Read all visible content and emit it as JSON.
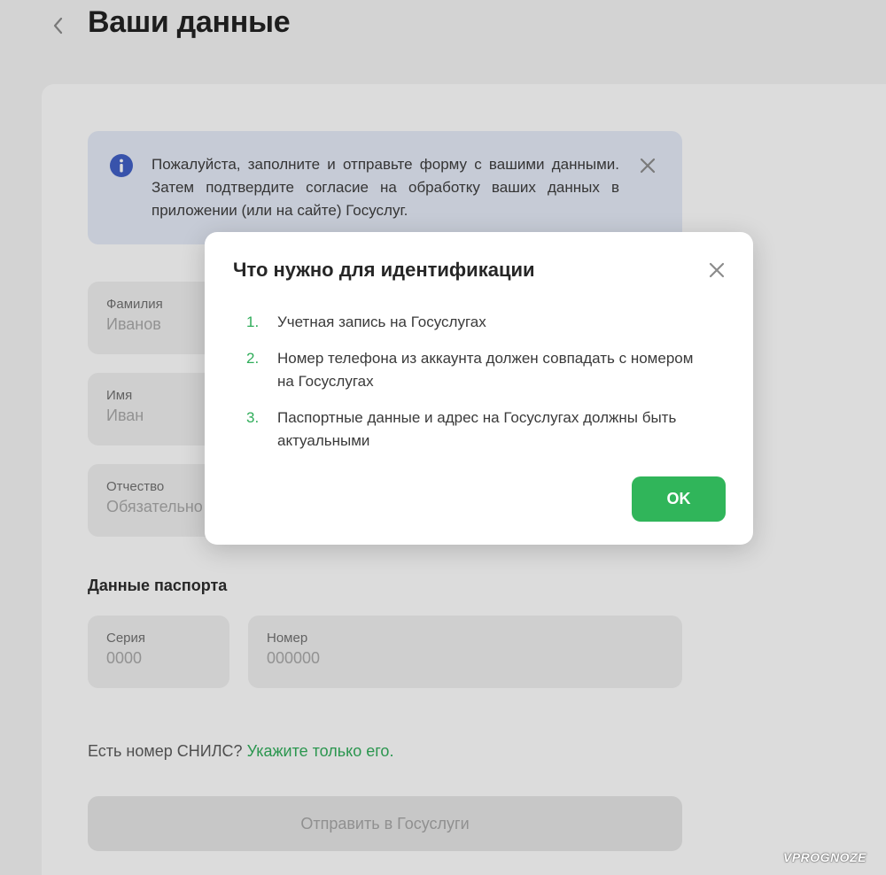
{
  "header": {
    "title": "Ваши данные"
  },
  "info_banner": {
    "text": "Пожалуйста, заполните и отправьте форму с вашими данными. Затем подтвердите согласие на обработку ваших данных в приложении (или на сайте) Госуслуг.",
    "icon": "info-icon",
    "accent_color": "#3f5fc6"
  },
  "form": {
    "surname": {
      "label": "Фамилия",
      "placeholder": "Иванов"
    },
    "name": {
      "label": "Имя",
      "placeholder": "Иван"
    },
    "patronymic": {
      "label": "Отчество",
      "placeholder": "Обязательно"
    },
    "passport_title": "Данные паспорта",
    "series": {
      "label": "Серия",
      "placeholder": "0000"
    },
    "number": {
      "label": "Номер",
      "placeholder": "000000"
    },
    "snils_prefix": "Есть номер СНИЛС?",
    "snils_link": "Укажите только его.",
    "submit_label": "Отправить в Госуслуги"
  },
  "modal": {
    "title": "Что нужно для идентификации",
    "steps": [
      {
        "num": "1.",
        "text": "Учетная запись на Госуслугах"
      },
      {
        "num": "2.",
        "text": "Номер телефона из аккаунта должен совпадать с номером на Госуслугах"
      },
      {
        "num": "3.",
        "text": "Паспортные данные и адрес на Госуслугах должны быть актуальными"
      }
    ],
    "ok_label": "OK",
    "ok_color": "#30b55a"
  },
  "watermark": "VPROGNOZE"
}
